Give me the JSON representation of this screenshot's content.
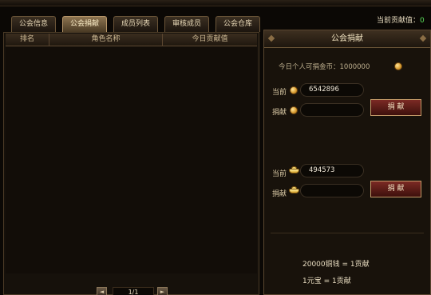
{
  "tabs": [
    {
      "label": "公会信息",
      "active": false
    },
    {
      "label": "公会捐献",
      "active": true
    },
    {
      "label": "成员列表",
      "active": false
    },
    {
      "label": "审核成员",
      "active": false
    },
    {
      "label": "公会仓库",
      "active": false
    }
  ],
  "current_contribution": {
    "label": "当前贡献值：",
    "value": "0"
  },
  "member_list": {
    "columns": [
      "排名",
      "角色名称",
      "今日贡献值"
    ],
    "rows": [],
    "page": "1/1",
    "prev_label": "◄",
    "next_label": "►"
  },
  "donate_panel": {
    "title": "公会捐献",
    "daily_limit": "今日个人可捐金币：1000000",
    "coin": {
      "current_label": "当前",
      "current_value": "6542896",
      "donate_label": "捐献",
      "donate_value": "",
      "button": "捐 献"
    },
    "ingot": {
      "current_label": "当前",
      "current_value": "494573",
      "donate_label": "捐献",
      "donate_value": "",
      "button": "捐 献"
    },
    "rates": [
      "20000铜钱 = 1贡献",
      "1元宝 = 1贡献"
    ]
  },
  "icons": {
    "coin": "gold-coin-icon",
    "ingot": "gold-ingot-icon"
  },
  "colors": {
    "contribution_value": "#5be05b",
    "button": "#7b2a24",
    "active_tab": "#8c7350"
  }
}
